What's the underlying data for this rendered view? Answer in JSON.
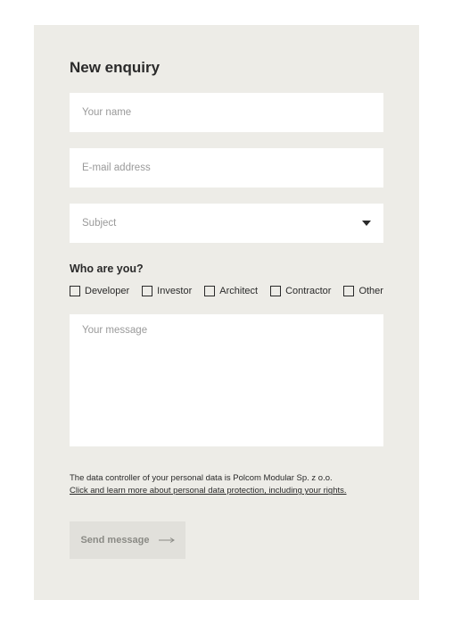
{
  "title": "New enquiry",
  "fields": {
    "name_placeholder": "Your name",
    "email_placeholder": "E-mail address",
    "subject_placeholder": "Subject",
    "message_placeholder": "Your message"
  },
  "who": {
    "heading": "Who are you?",
    "options": [
      "Developer",
      "Investor",
      "Architect",
      "Contractor",
      "Other"
    ]
  },
  "notice": {
    "line1": "The data controller of your personal data is Polcom Modular Sp. z o.o.",
    "line2": "Click and learn more about personal data protection, including your rights."
  },
  "submit": {
    "label": "Send message"
  }
}
